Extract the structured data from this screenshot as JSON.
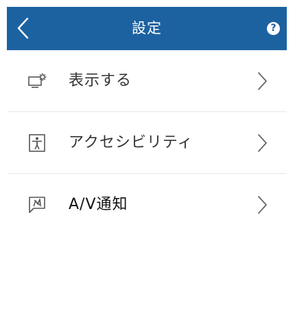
{
  "header": {
    "title": "設定",
    "back_icon": "chevron-left-icon",
    "help_label": "?",
    "background_color": "#1c62a1"
  },
  "items": [
    {
      "label": "表示する",
      "icon": "display-settings-icon"
    },
    {
      "label": "アクセシビリティ",
      "icon": "accessibility-icon"
    },
    {
      "label": "A/V通知",
      "icon": "av-notification-icon"
    }
  ]
}
